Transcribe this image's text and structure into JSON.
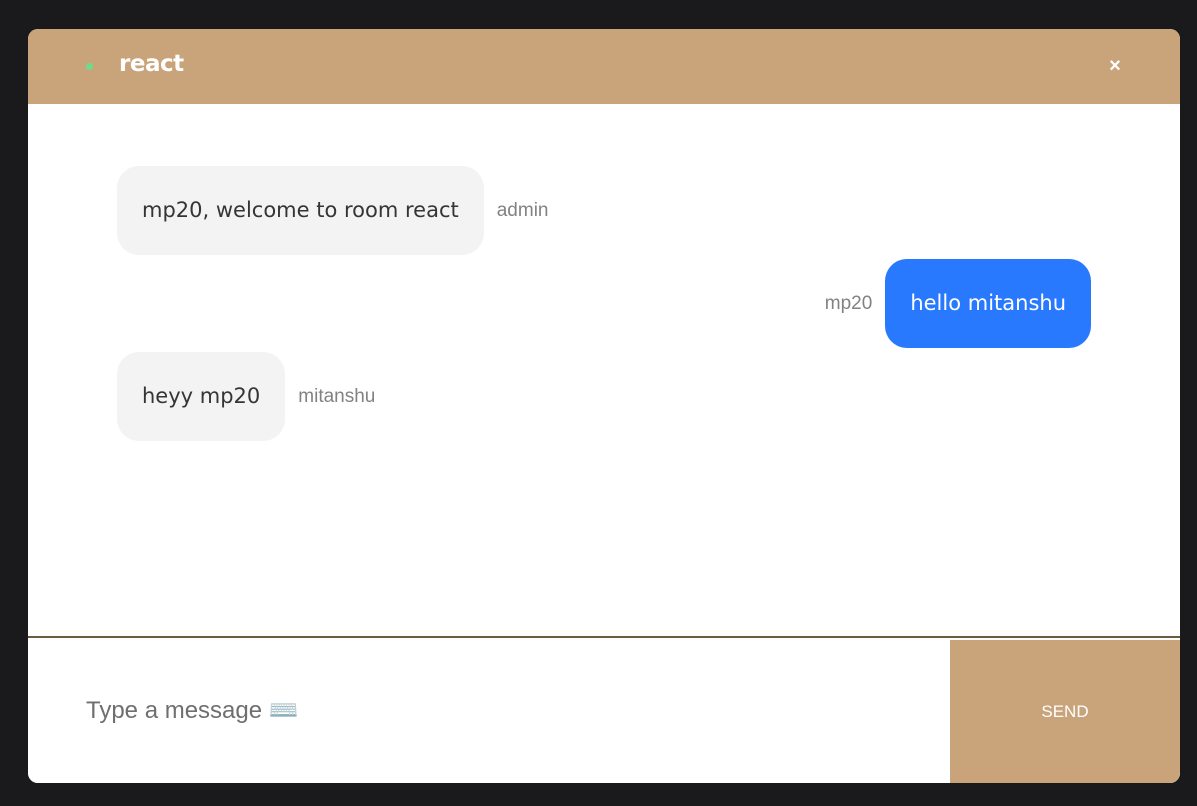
{
  "header": {
    "room_name": "react",
    "close_label": "×"
  },
  "messages": [
    {
      "text": "mp20, welcome to room react",
      "sender": "admin",
      "side": "left"
    },
    {
      "text": "hello mitanshu",
      "sender": "mp20",
      "side": "right"
    },
    {
      "text": "heyy mp20",
      "sender": "mitanshu",
      "side": "left"
    }
  ],
  "composer": {
    "placeholder": "Type a message ⌨️",
    "value": "",
    "send_label": "SEND"
  },
  "colors": {
    "accent": "#c9a47a",
    "my_bubble": "#2979ff",
    "other_bubble": "#f3f3f3",
    "online_dot": "#6fdc8c",
    "background": "#1a1a1d"
  }
}
